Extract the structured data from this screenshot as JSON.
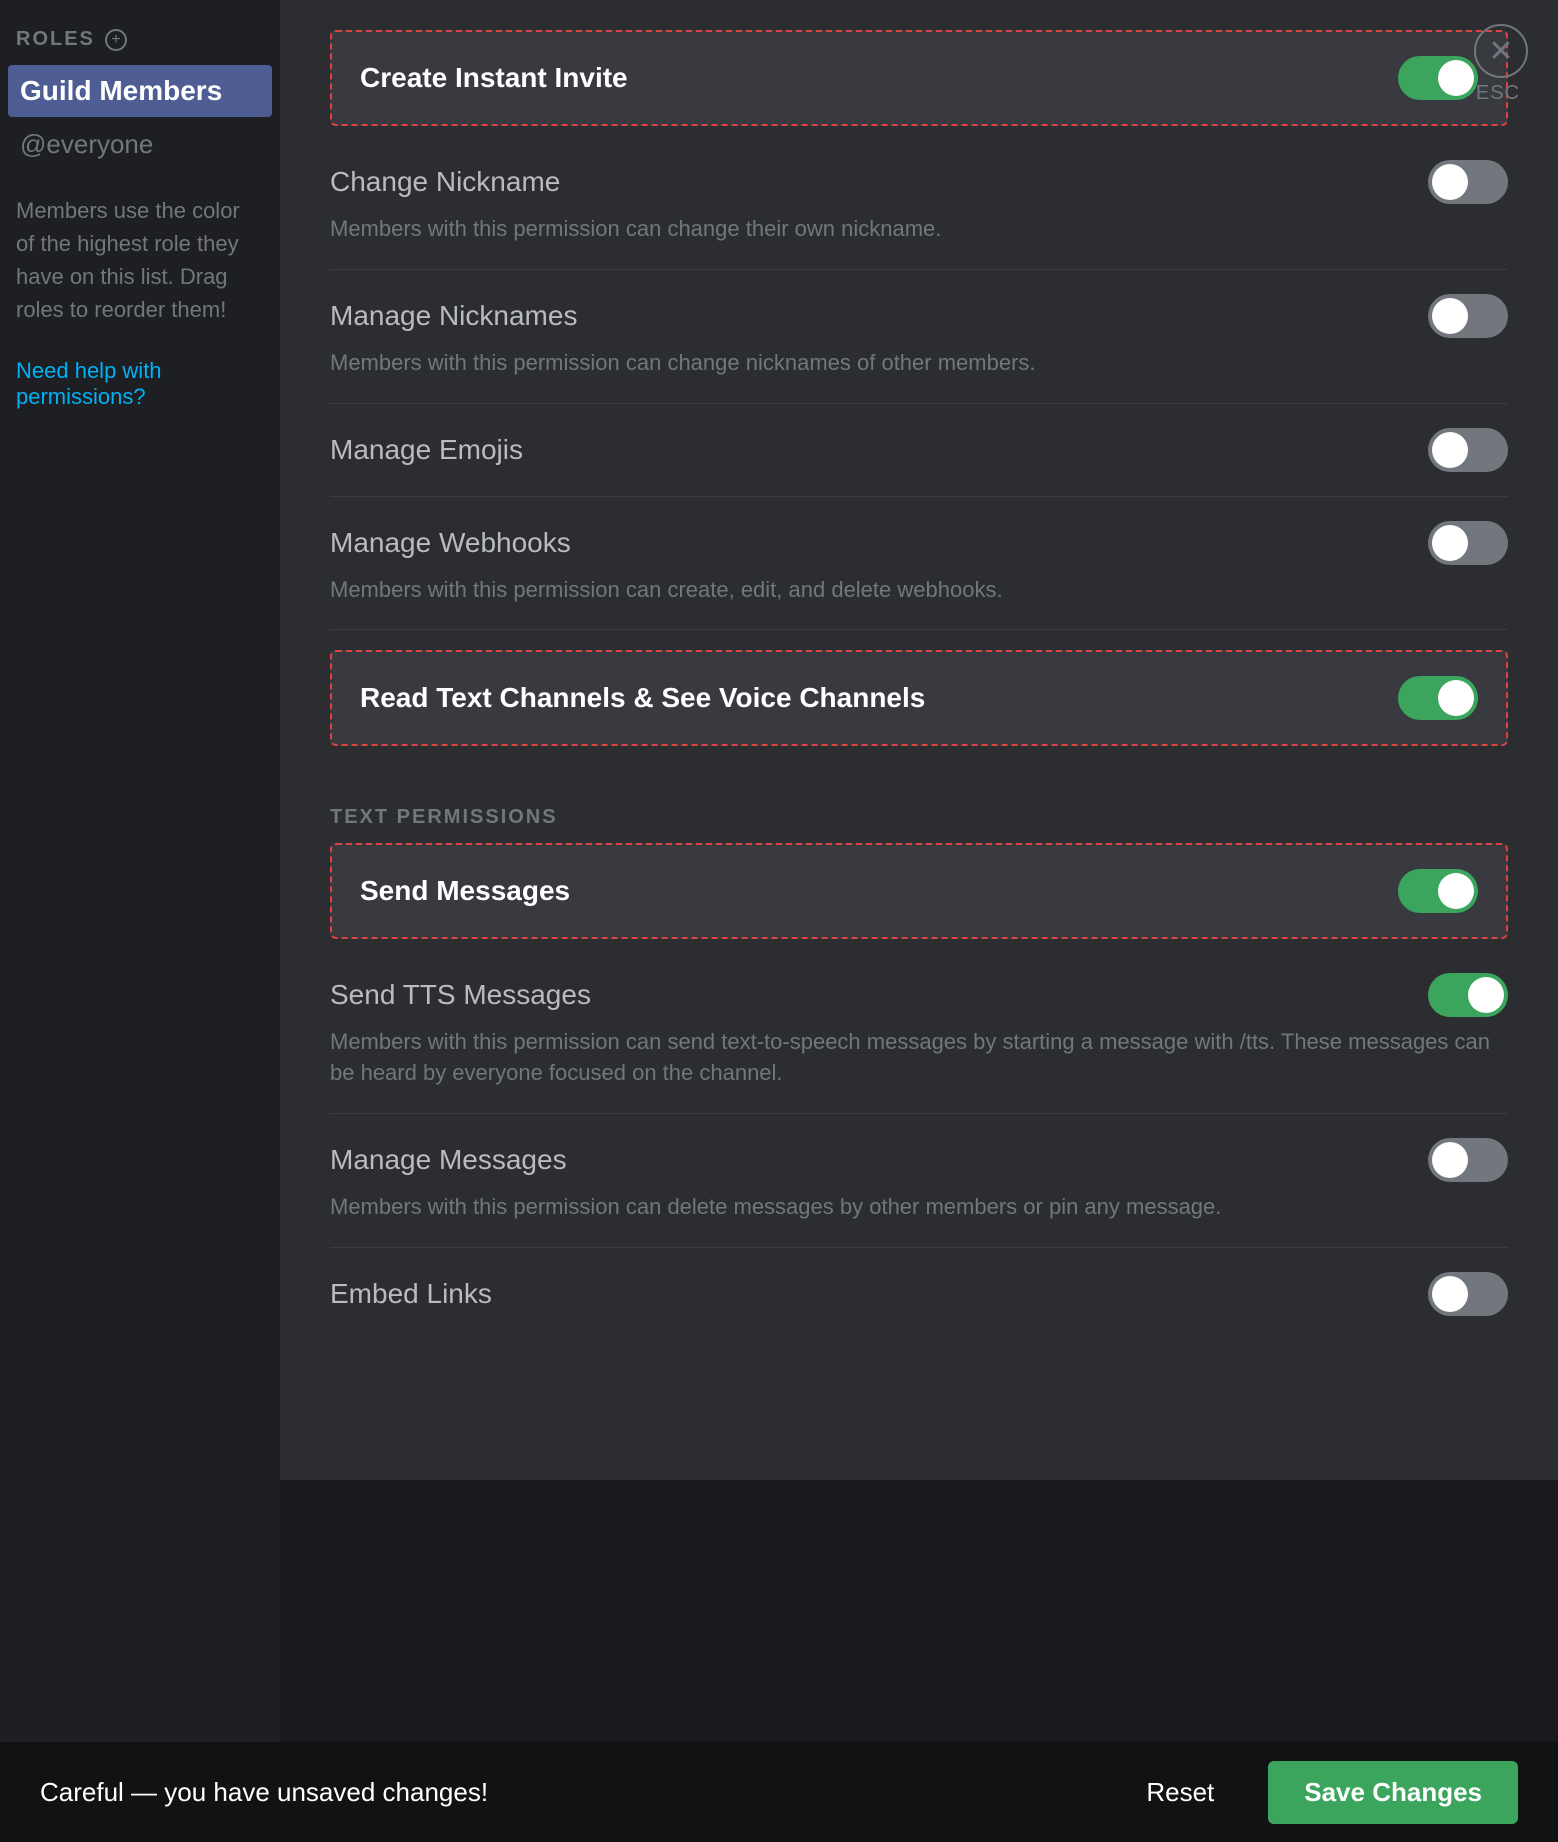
{
  "sidebar": {
    "roles_label": "ROLES",
    "add_icon": "+",
    "guild_members": "Guild Members",
    "everyone": "@everyone",
    "info_text": "Members use the color of the highest role they have on this list. Drag roles to reorder them!",
    "help_link": "Need help with permissions?"
  },
  "close_button": "✕",
  "esc_label": "ESC",
  "permissions": [
    {
      "id": "create-instant-invite",
      "name": "Create Instant Invite",
      "desc": "",
      "enabled": true,
      "highlighted": true,
      "section": null
    },
    {
      "id": "change-nickname",
      "name": "Change Nickname",
      "desc": "Members with this permission can change their own nickname.",
      "enabled": false,
      "highlighted": false,
      "section": null
    },
    {
      "id": "manage-nicknames",
      "name": "Manage Nicknames",
      "desc": "Members with this permission can change nicknames of other members.",
      "enabled": false,
      "highlighted": false,
      "section": null
    },
    {
      "id": "manage-emojis",
      "name": "Manage Emojis",
      "desc": "",
      "enabled": false,
      "highlighted": false,
      "section": null
    },
    {
      "id": "manage-webhooks",
      "name": "Manage Webhooks",
      "desc": "Members with this permission can create, edit, and delete webhooks.",
      "enabled": false,
      "highlighted": false,
      "section": null
    },
    {
      "id": "read-text-channels",
      "name": "Read Text Channels & See Voice Channels",
      "desc": "",
      "enabled": true,
      "highlighted": true,
      "section": null
    },
    {
      "id": "send-messages",
      "name": "Send Messages",
      "desc": "",
      "enabled": true,
      "highlighted": true,
      "section": "TEXT PERMISSIONS"
    },
    {
      "id": "send-tts-messages",
      "name": "Send TTS Messages",
      "desc": "Members with this permission can send text-to-speech messages by starting a message with /tts. These messages can be heard by everyone focused on the channel.",
      "enabled": true,
      "highlighted": false,
      "section": null
    },
    {
      "id": "manage-messages",
      "name": "Manage Messages",
      "desc": "Members with this permission can delete messages by other members or pin any message.",
      "enabled": false,
      "highlighted": false,
      "section": null
    },
    {
      "id": "embed-links",
      "name": "Embed Links",
      "desc": "",
      "enabled": false,
      "highlighted": false,
      "section": null
    }
  ],
  "bottom_bar": {
    "message": "Careful — you have unsaved changes!",
    "reset_label": "Reset",
    "save_label": "Save Changes"
  }
}
